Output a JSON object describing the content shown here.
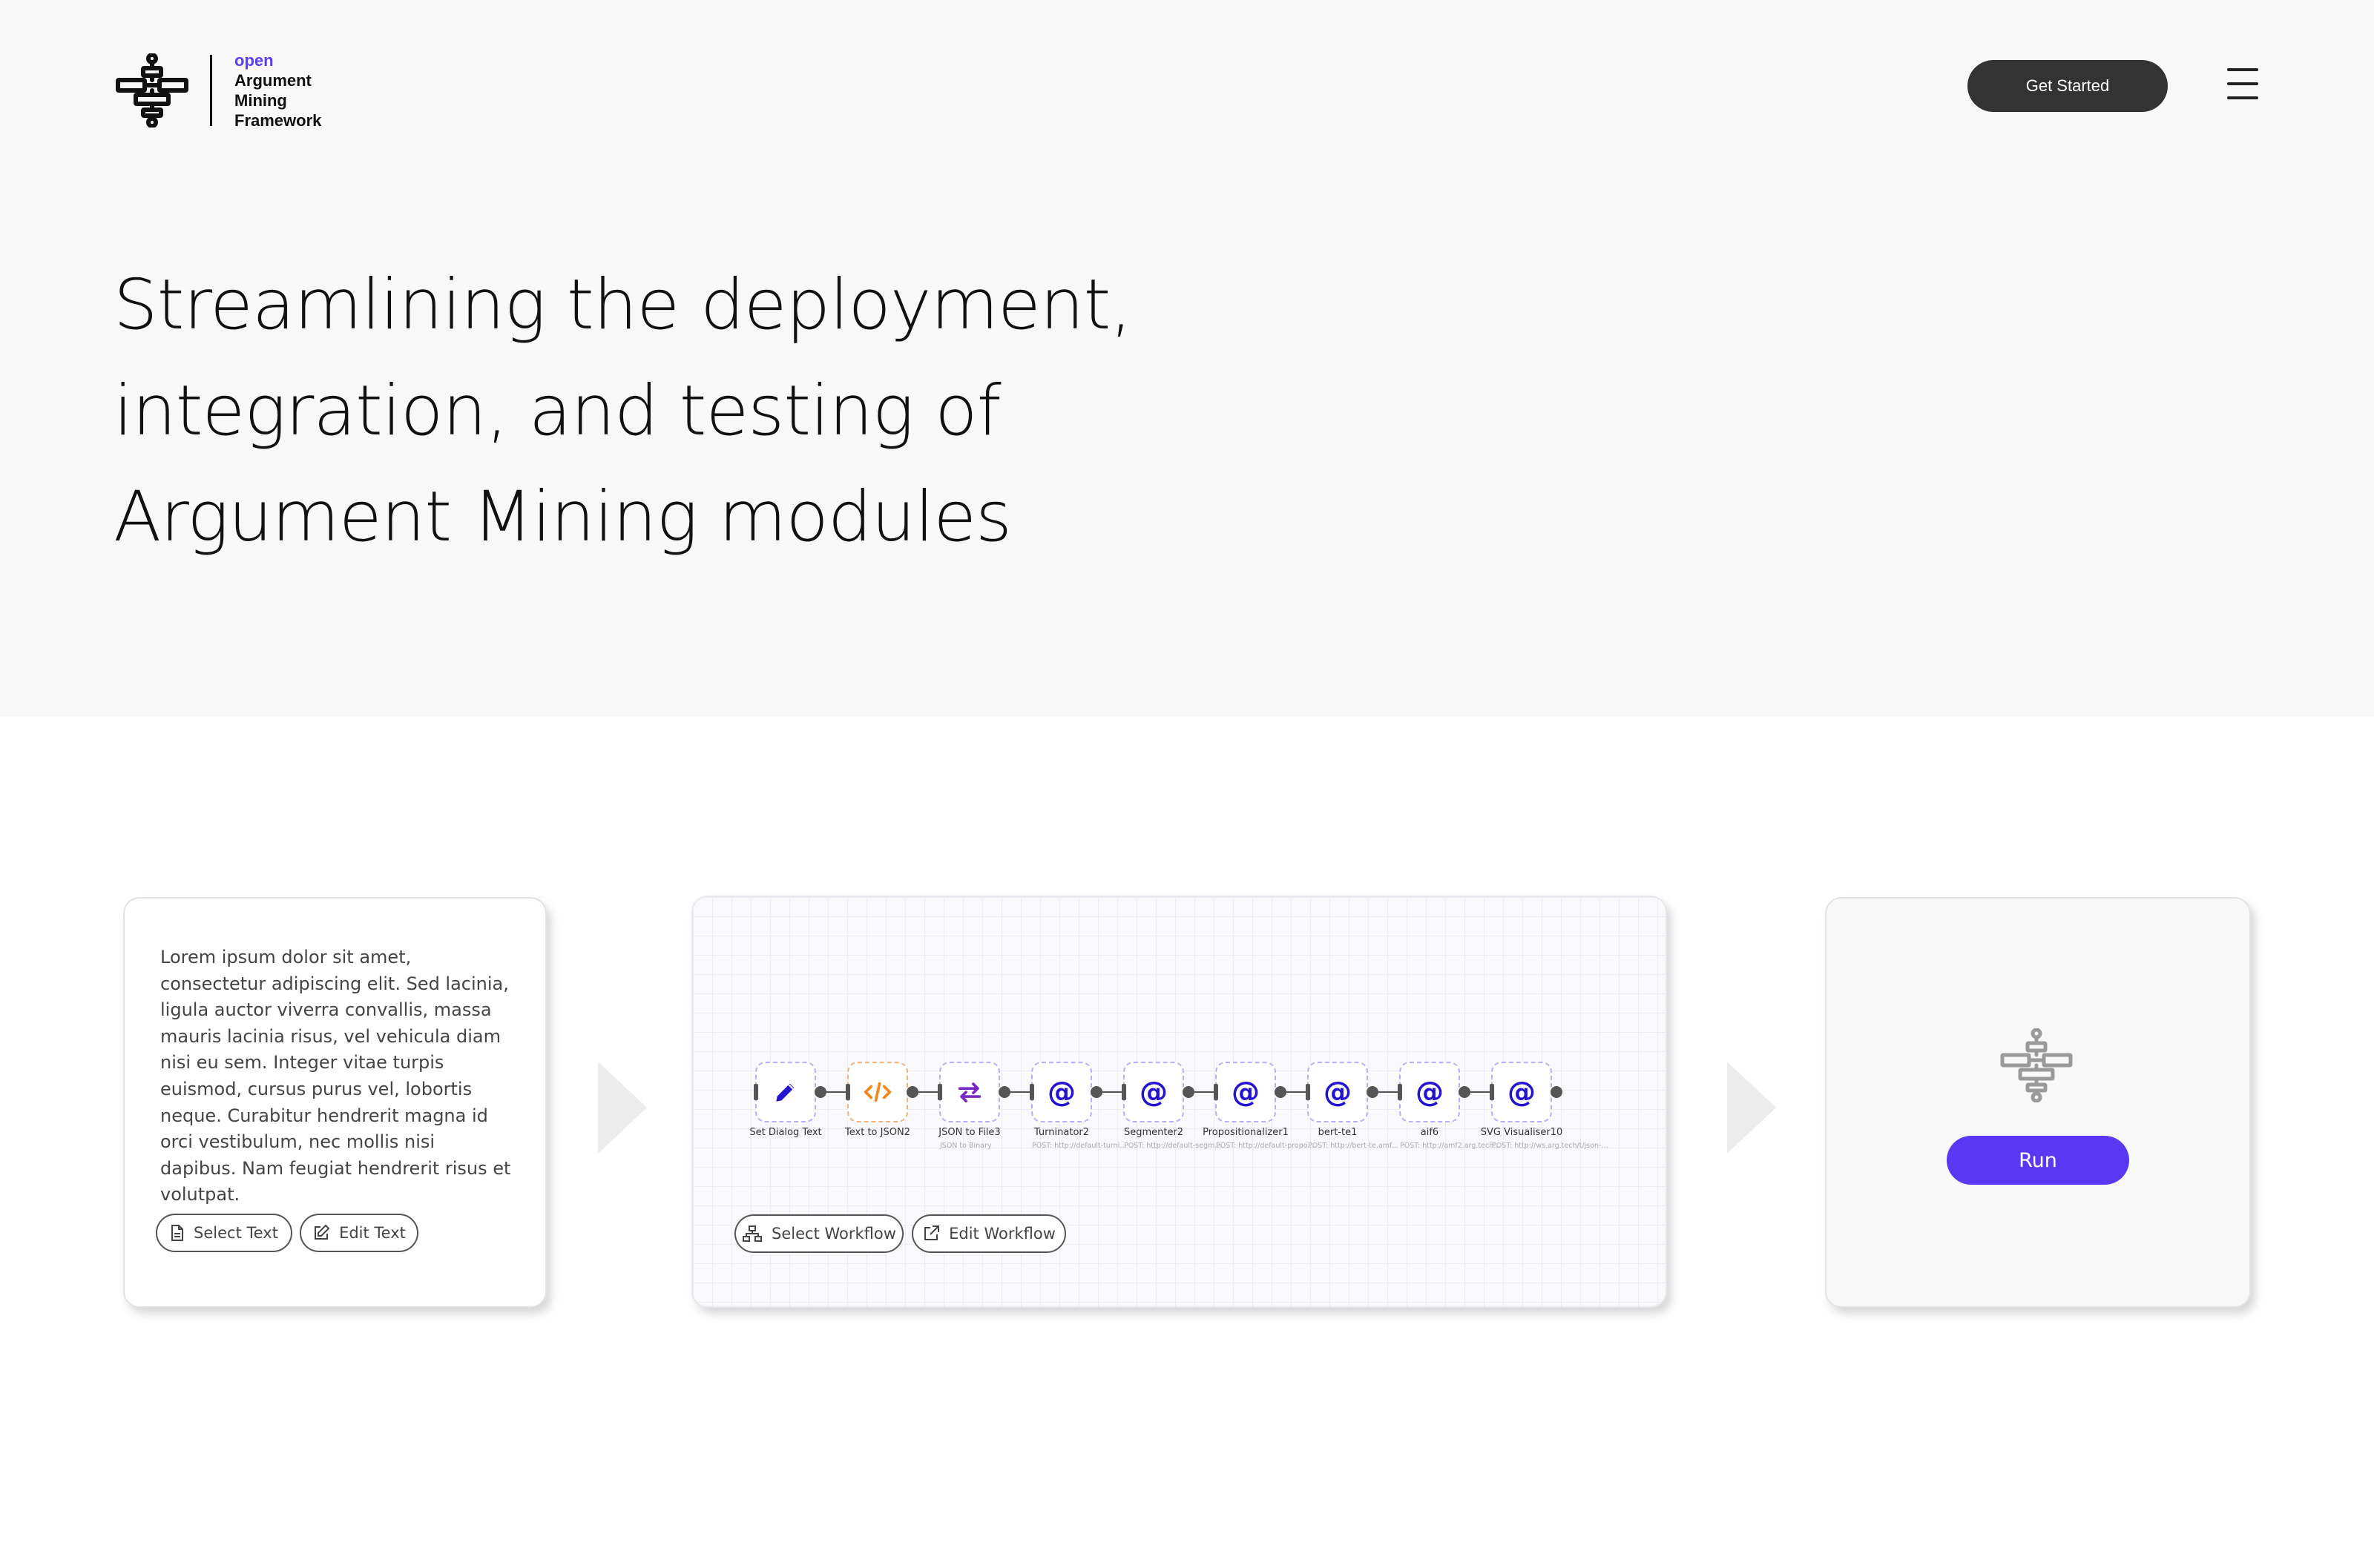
{
  "header": {
    "logo": {
      "line1": "open",
      "line2": "Argument",
      "line3": "Mining",
      "line4": "Framework",
      "icon": "flowchart-logo-icon"
    },
    "cta_label": "Get Started",
    "menu_icon": "hamburger-menu-icon"
  },
  "hero": {
    "headline_lines": [
      "Streamlining the deployment,",
      "integration, and testing of",
      "Argument Mining modules"
    ]
  },
  "text_panel": {
    "body": "Lorem ipsum dolor sit amet, consectetur adipiscing elit. Sed lacinia, ligula auctor viverra convallis, massa mauris lacinia risus, vel vehicula diam nisi eu sem. Integer vitae turpis euismod, cursus purus vel, lobortis neque. Curabitur hendrerit magna id orci vestibulum, nec mollis nisi dapibus. Nam feugiat hendrerit risus et volutpat.",
    "select_label": "Select Text",
    "edit_label": "Edit Text"
  },
  "workflow_panel": {
    "nodes": [
      {
        "label": "Set Dialog Text",
        "sub": "",
        "icon": "pencil-icon"
      },
      {
        "label": "Text to JSON2",
        "sub": "",
        "icon": "code-icon"
      },
      {
        "label": "JSON to File3",
        "sub": "JSON to Binary",
        "icon": "swap-arrows-icon"
      },
      {
        "label": "Turninator2",
        "sub": "POST: http://default-turni...",
        "icon": "at-sign-icon"
      },
      {
        "label": "Segmenter2",
        "sub": "POST: http://default-segm...",
        "icon": "at-sign-icon"
      },
      {
        "label": "Propositionalizer1",
        "sub": "POST: http://default-propo...",
        "icon": "at-sign-icon"
      },
      {
        "label": "bert-te1",
        "sub": "POST: http://bert-te.amf...",
        "icon": "at-sign-icon"
      },
      {
        "label": "aif6",
        "sub": "POST: http://amf2.arg.tech...",
        "icon": "at-sign-icon"
      },
      {
        "label": "SVG Visualiser10",
        "sub": "POST: http://ws.arg.tech/t/json-...",
        "icon": "at-sign-icon"
      }
    ],
    "select_label": "Select Workflow",
    "edit_label": "Edit Workflow"
  },
  "run_panel": {
    "icon": "flowchart-logo-icon",
    "run_label": "Run"
  },
  "colors": {
    "accent": "#5a37f2",
    "node_icon": "#2312d0",
    "code_icon": "#f08a1c",
    "dark_button": "#333333",
    "hero_bg": "#f8f8f8"
  }
}
